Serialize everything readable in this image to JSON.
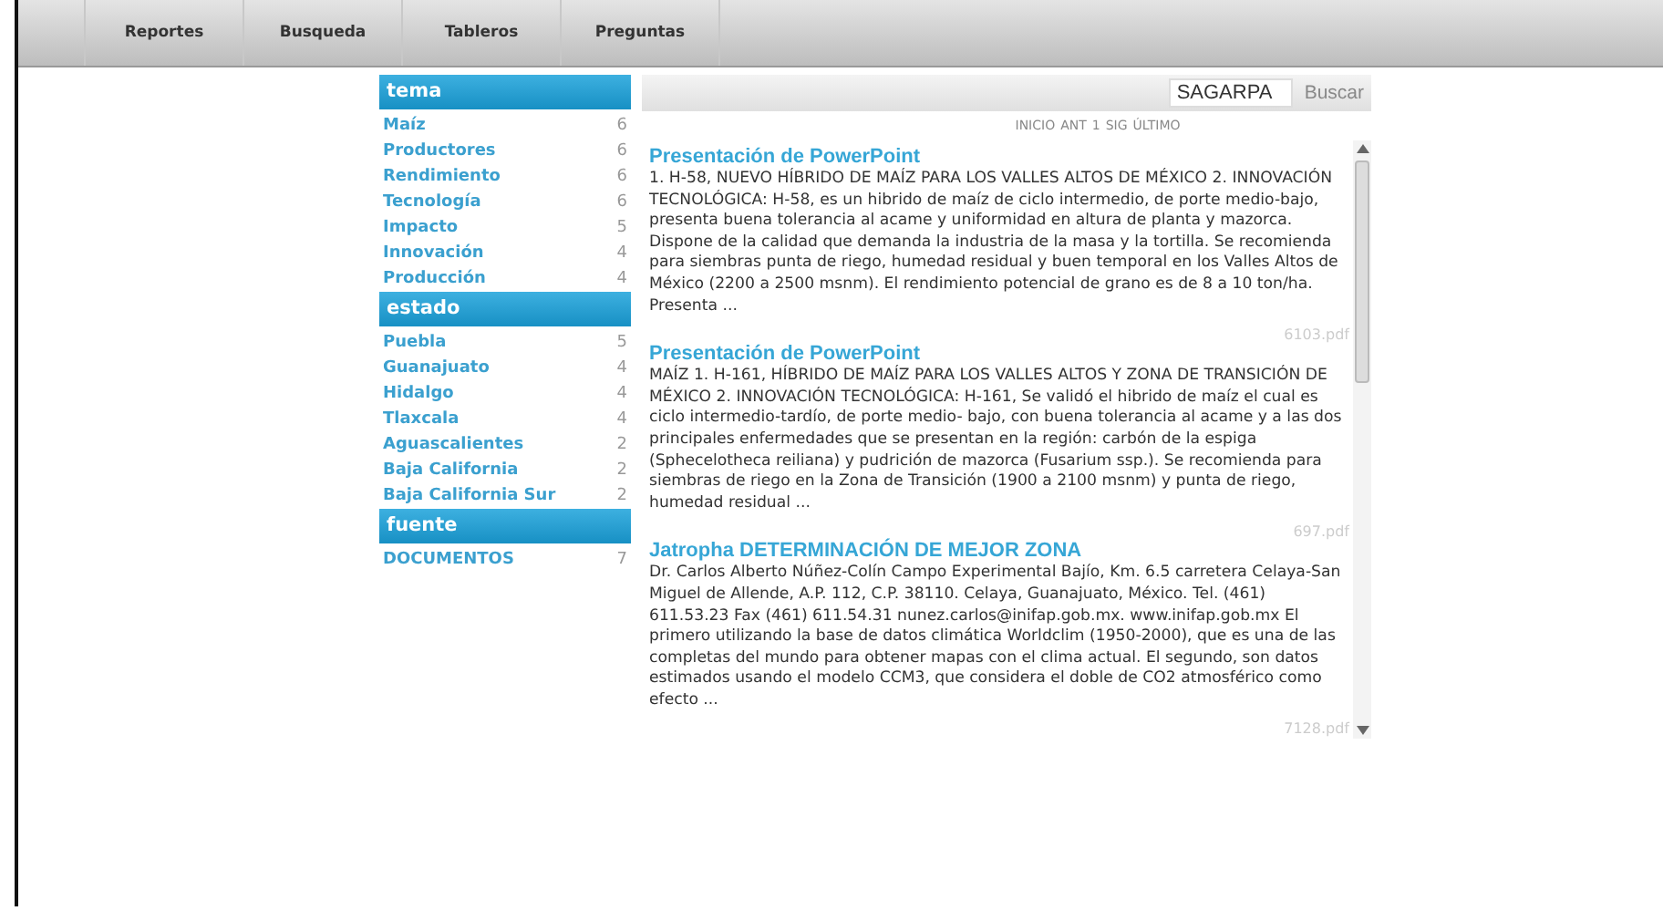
{
  "nav": {
    "items": [
      "Reportes",
      "Busqueda",
      "Tableros",
      "Preguntas"
    ]
  },
  "facets": [
    {
      "title": "tema",
      "items": [
        {
          "label": "Maíz",
          "count": "6"
        },
        {
          "label": "Productores",
          "count": "6"
        },
        {
          "label": "Rendimiento",
          "count": "6"
        },
        {
          "label": "Tecnología",
          "count": "6"
        },
        {
          "label": "Impacto",
          "count": "5"
        },
        {
          "label": "Innovación",
          "count": "4"
        },
        {
          "label": "Producción",
          "count": "4"
        }
      ]
    },
    {
      "title": "estado",
      "items": [
        {
          "label": "Puebla",
          "count": "5"
        },
        {
          "label": "Guanajuato",
          "count": "4"
        },
        {
          "label": "Hidalgo",
          "count": "4"
        },
        {
          "label": "Tlaxcala",
          "count": "4"
        },
        {
          "label": "Aguascalientes",
          "count": "2"
        },
        {
          "label": "Baja California",
          "count": "2"
        },
        {
          "label": "Baja California Sur",
          "count": "2"
        }
      ]
    },
    {
      "title": "fuente",
      "items": [
        {
          "label": "DOCUMENTOS",
          "count": "7"
        }
      ]
    }
  ],
  "search": {
    "value": "SAGARPA",
    "button": "Buscar"
  },
  "pagination": [
    "INICIO",
    "ANT",
    "1",
    "SIG",
    "ÚLTIMO"
  ],
  "results": [
    {
      "title": "Presentación de PowerPoint",
      "snippet": "1. H-58, NUEVO HÍBRIDO DE MAÍZ PARA LOS VALLES ALTOS DE MÉXICO 2. INNOVACIÓN TECNOLÓGICA: H-58, es un hibrido de maíz de ciclo intermedio, de porte medio-bajo, presenta buena tolerancia al acame y uniformidad en altura de planta y mazorca. Dispone de la calidad que demanda la industria de la masa y la tortilla. Se recomienda para siembras punta de riego, humedad residual y buen temporal en los Valles Altos de México (2200 a 2500 msnm). El rendimiento potencial de grano es de 8 a 10 ton/ha. Presenta ...",
      "file": "6103.pdf"
    },
    {
      "title": "Presentación de PowerPoint",
      "snippet": "MAÍZ 1. H-161, HÍBRIDO DE MAÍZ PARA LOS VALLES ALTOS Y ZONA DE TRANSICIÓN DE MÉXICO 2. INNOVACIÓN TECNOLÓGICA: H-161, Se validó el hibrido de maíz el cual es ciclo intermedio-tardío, de porte medio- bajo, con buena tolerancia al acame y a las dos principales enfermedades que se presentan en la región: carbón de la espiga (Sphecelotheca reiliana) y pudrición de mazorca (Fusarium ssp.). Se recomienda para siembras de riego en la Zona de Transición (1900 a 2100 msnm) y punta de riego, humedad residual ...",
      "file": "697.pdf"
    },
    {
      "title": "Jatropha DETERMINACIÓN DE MEJOR ZONA",
      "snippet": "Dr. Carlos Alberto Núñez-Colín Campo Experimental Bajío, Km. 6.5 carretera Celaya-San Miguel de Allende, A.P. 112, C.P. 38110. Celaya, Guanajuato, México. Tel. (461) 611.53.23 Fax (461) 611.54.31 nunez.carlos@inifap.gob.mx. www.inifap.gob.mx El primero utilizando la base de datos climática Worldclim (1950-2000), que es una de las completas del mundo para obtener mapas con el clima actual. El segundo, son datos estimados usando el modelo CCM3, que considera el doble de CO2 atmosférico como efecto ...",
      "file": "7128.pdf"
    }
  ]
}
